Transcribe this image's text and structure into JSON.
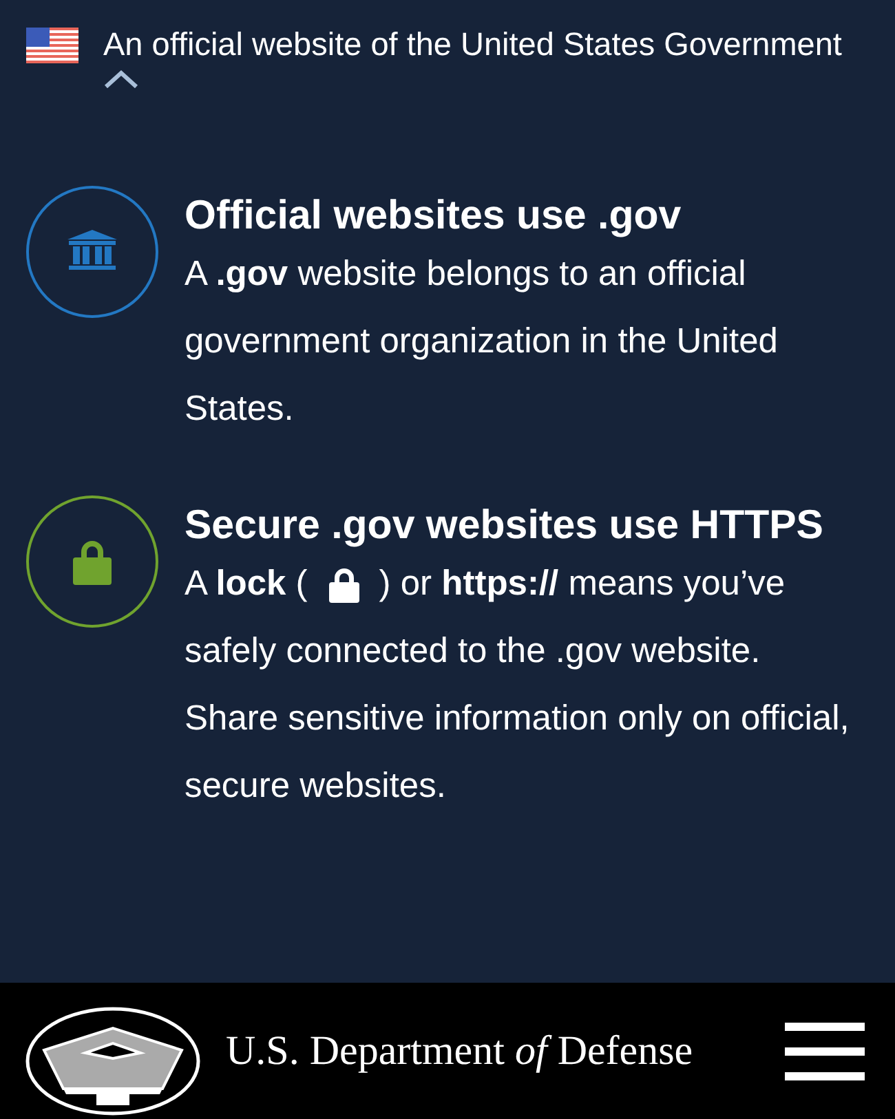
{
  "banner": {
    "text": "An official website of the United States Government",
    "expanded": true
  },
  "sections": [
    {
      "kind": "building",
      "color": "#2378c3",
      "title": "Official websites use .gov",
      "body": "A **.gov** website belongs to an official government organization in the United States."
    },
    {
      "kind": "lock",
      "color": "#70a32e",
      "title": "Secure .gov websites use HTTPS",
      "lead_parts": [
        "A **lock** (",
        ") or **https://** means you’ve"
      ],
      "body": "safely connected to the .gov website. Share sensitive information only on official, secure websites."
    }
  ],
  "footer": {
    "title": "U.S. Department *of* Defense"
  }
}
